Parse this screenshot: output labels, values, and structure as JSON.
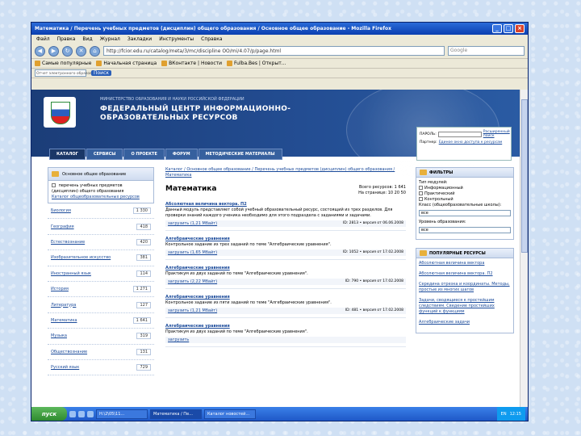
{
  "window": {
    "title": "Математика / Перечень учебных предметов (дисциплин) общего образования / Основное общее образование - Mozilla Firefox",
    "controls": [
      "_",
      "□",
      "×"
    ]
  },
  "menu": [
    "Файл",
    "Правка",
    "Вид",
    "Журнал",
    "Закладки",
    "Инструменты",
    "Справка"
  ],
  "nav": {
    "url": "http://fcior.edu.ru/catalog/meta/3/mc/discipline OO/mi/4.07/p/page.html",
    "search_engine": "Google"
  },
  "bookmarks": [
    "Самые популярные",
    "Начальная страница",
    "ВКонтакте | Новости",
    "Fulba.Bes | Открыт..."
  ],
  "toolbar": {
    "search_btn": "Поиск",
    "search_placeholder": "Отчет электронного образова"
  },
  "site": {
    "ministry": "МИНИСТЕРСТВО ОБРАЗОВАНИЯ И НАУКИ РОССИЙСКОЙ ФЕДЕРАЦИИ",
    "center": "ФЕДЕРАЛЬНЫЙ ЦЕНТР ИНФОРМАЦИОННО-ОБРАЗОВАТЕЛЬНЫХ РЕСУРСОВ",
    "login": {
      "label": "ПАРОЛЬ:",
      "link": "Расширенный поиск",
      "partner_label": "Партнер:",
      "partner_link": "Единое окно доступа к ресурсам"
    },
    "tabs": [
      "КАТАЛОГ",
      "СЕРВИСЫ",
      "О ПРОЕКТЕ",
      "ФОРУМ",
      "МЕТОДИЧЕСКИЕ МАТЕРИАЛЫ"
    ]
  },
  "left": {
    "header": "Основное общее образование",
    "sub_text": "перечень учебных предметов (дисциплин) общего образования",
    "sub_link": "Каталог общеобразовательных ресурсов",
    "subjects": [
      {
        "name": "Биология",
        "count": "1 330"
      },
      {
        "name": "География",
        "count": "418"
      },
      {
        "name": "Естествознание",
        "count": "420"
      },
      {
        "name": "Изобразительное искусство",
        "count": "381"
      },
      {
        "name": "Иностранный язык",
        "count": "114"
      },
      {
        "name": "История",
        "count": "1 271"
      },
      {
        "name": "Литература",
        "count": "127"
      },
      {
        "name": "Математика",
        "count": "1 641"
      },
      {
        "name": "Музыка",
        "count": "319"
      },
      {
        "name": "Обществознание",
        "count": "131"
      },
      {
        "name": "Русский язык",
        "count": "729"
      }
    ]
  },
  "main": {
    "breadcrumb": "Каталог / Основное общее образование / Перечень учебных предметов (дисциплин) общего образования / Математика",
    "title": "Математика",
    "meta_total": "Всего ресурсов: 1 641",
    "meta_page": "На странице: 10 20 50",
    "items": [
      {
        "title": "Абсолютная величина вектора. П2",
        "desc": "Данный модуль представляет собой учебный образовательный ресурс, состоящий из трех разделов. Для проверки знаний каждого ученика необходимо для этого подраздела с заданиями и задачами.",
        "download": "загрузить (1,21 Мбайт)",
        "info": "ID: 2813 • версия от 06.06.2008"
      },
      {
        "title": "Алгебраические уравнения",
        "desc": "Контрольное задание из трех заданий по теме \"Алгебраические уравнения\".",
        "download": "загрузить (1,65 Мбайт)",
        "info": "ID: 1052 • версия от 17.02.2008"
      },
      {
        "title": "Алгебраические уравнения",
        "desc": "Практикум из двух заданий по теме \"Алгебраические уравнения\".",
        "download": "загрузить (2,22 Мбайт)",
        "info": "ID: 790 • версия от 17.02.2008"
      },
      {
        "title": "Алгебраические уравнения",
        "desc": "Контрольное задание из пяти заданий по теме \"Алгебраические уравнения\".",
        "download": "загрузить (1,21 Мбайт)",
        "info": "ID: 481 • версия от 17.02.2008"
      },
      {
        "title": "Алгебраические уравнения",
        "desc": "Практикум из двух заданий по теме \"Алгебраические уравнения\".",
        "download": "загрузить",
        "info": ""
      }
    ]
  },
  "right": {
    "filter_header": "ФИЛЬТРЫ",
    "type_label": "Тип модулей:",
    "types": [
      "Информационный",
      "Практический",
      "Контрольный"
    ],
    "class_label": "Класс (общеобразовательные школы):",
    "class_value": "все",
    "level_label": "Уровень образования:",
    "level_value": "все",
    "popular_header": "ПОПУЛЯРНЫЕ РЕСУРСЫ",
    "popular": [
      "Абсолютная величина вектора",
      "Абсолютная величина вектора. П2",
      "Середина отрезка и координаты. Методы, простые из многих шагов",
      "Задачи, сводящиеся к простейшим следствиям. Сведение простейших функций к функциям",
      "Алгебраические задачи"
    ]
  },
  "taskbar": {
    "start": "пуск",
    "tasks": [
      "Н:\\2\\05\\11...",
      "Математика / Пе...",
      "Каталог новостей..."
    ],
    "lang": "EN",
    "clock": "12:15"
  }
}
